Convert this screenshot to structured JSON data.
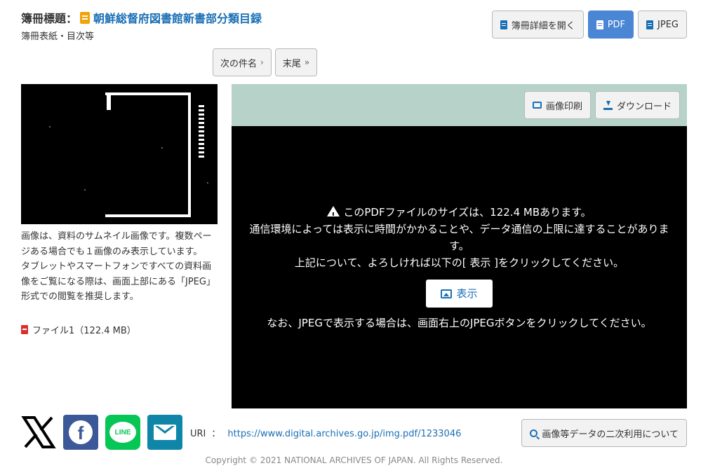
{
  "header": {
    "title_label": "簿冊標題：",
    "title_link": "朝鮮総督府図書館新書部分類目録",
    "subtitle": "簿冊表紙・目次等",
    "buttons": {
      "detail": "簿冊詳細を開く",
      "pdf": "PDF",
      "jpeg": "JPEG"
    }
  },
  "nav": {
    "next_item": "次の件名",
    "last": "末尾"
  },
  "thumbnail": {
    "description_lines": [
      "画像は、資料のサムネイル画像です。複数ページある場合でも１画像のみ表示しています。",
      "タブレットやスマートフォンですべての資料画像をご覧になる際は、画面上部にある「JPEG」形式での閲覧を推奨します。"
    ],
    "file_link": "ファイル1（122.4 MB）"
  },
  "viewer": {
    "print_label": "画像印刷",
    "download_label": "ダウンロード",
    "warning_line1": "このPDFファイルのサイズは、122.4 MBあります。",
    "warning_line2": "通信環境によっては表示に時間がかかることや、データ通信の上限に達することがあります。",
    "warning_line3": "上記について、よろしければ以下の[ 表示 ]をクリックしてください。",
    "show_label": "表示",
    "note": "なお、JPEGで表示する場合は、画面右上のJPEGボタンをクリックしてください。"
  },
  "footer": {
    "uri_label": "URI",
    "uri_sep": "：",
    "uri": "https://www.digital.archives.go.jp/img.pdf/1233046",
    "reuse_label": "画像等データの二次利用について",
    "copyright": "Copyright © 2021 NATIONAL ARCHIVES OF JAPAN. All Rights Reserved.",
    "social": {
      "facebook_glyph": "f",
      "line_text": "LINE"
    }
  },
  "colors": {
    "link": "#1a6fb5",
    "primary_button": "#4a86d4",
    "viewer_bar": "#b7d3c9",
    "facebook": "#3b5998",
    "line": "#06c755",
    "mail": "#0f86a8",
    "pdf_red": "#d9302c",
    "book_orange": "#f0a30a"
  },
  "icons": {
    "title": "book-icon",
    "detail": "document-icon",
    "pdf": "pdf-file-icon",
    "jpeg": "image-file-icon",
    "print": "printer-icon",
    "download": "download-icon",
    "warning": "warning-triangle-icon",
    "show": "images-icon",
    "reuse": "search-icon"
  }
}
